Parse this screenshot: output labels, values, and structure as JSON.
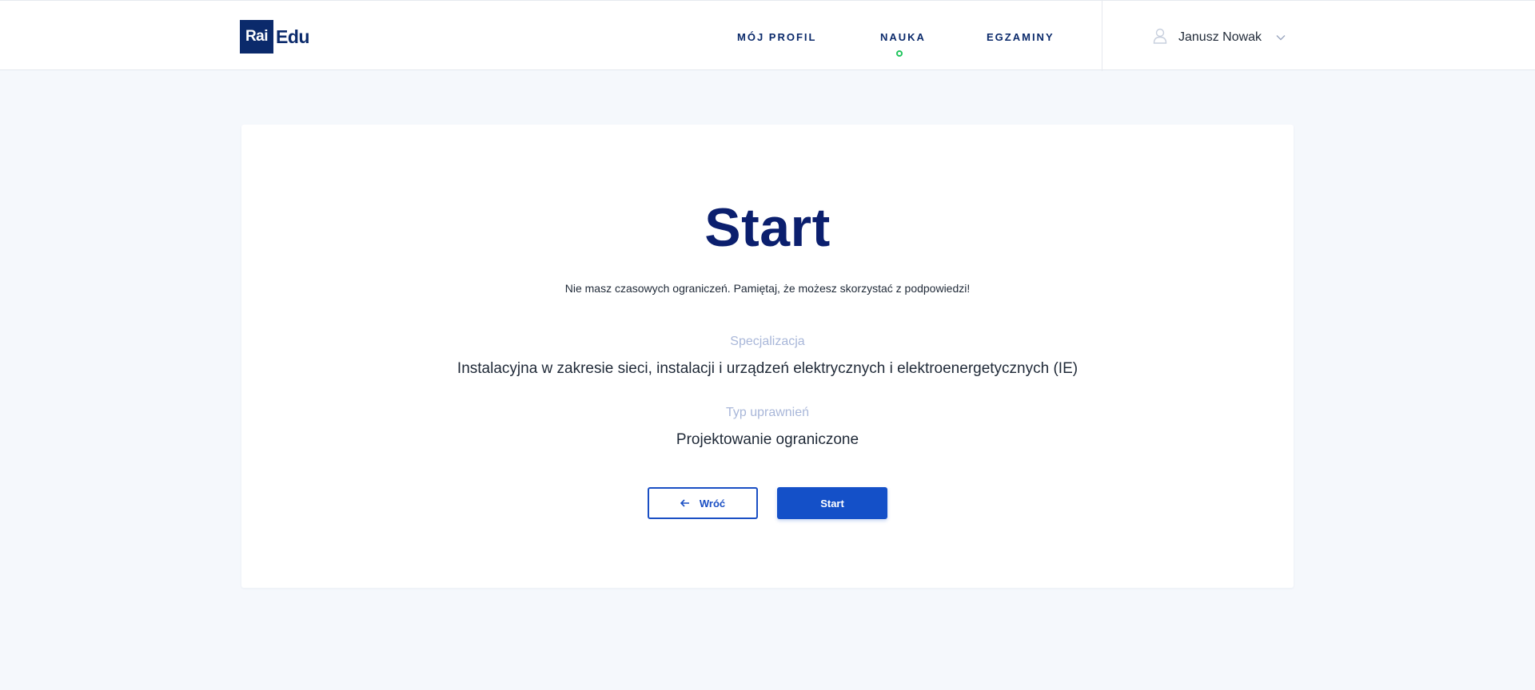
{
  "brand": {
    "logo_box": "Rai",
    "logo_text": "Edu",
    "primary_color": "#0b2a6b",
    "accent_color": "#1450c8",
    "active_indicator_color": "#22c55e"
  },
  "nav": {
    "items": [
      {
        "label": "MÓJ PROFIL",
        "active": false
      },
      {
        "label": "NAUKA",
        "active": true
      },
      {
        "label": "EGZAMINY",
        "active": false
      }
    ]
  },
  "user": {
    "name": "Janusz Nowak",
    "icon": "user-icon",
    "menu_icon": "chevron-down-icon"
  },
  "main": {
    "title": "Start",
    "subtitle": "Nie masz czasowych ograniczeń. Pamiętaj, że możesz skorzystać z podpowiedzi!",
    "fields": [
      {
        "label": "Specjalizacja",
        "value": "Instalacyjna w zakresie sieci, instalacji i urządzeń elektrycznych i elektroenergetycznych (IE)"
      },
      {
        "label": "Typ uprawnień",
        "value": "Projektowanie ograniczone"
      }
    ],
    "buttons": {
      "back_label": "Wróć",
      "back_icon": "arrow-left-icon",
      "start_label": "Start"
    }
  }
}
